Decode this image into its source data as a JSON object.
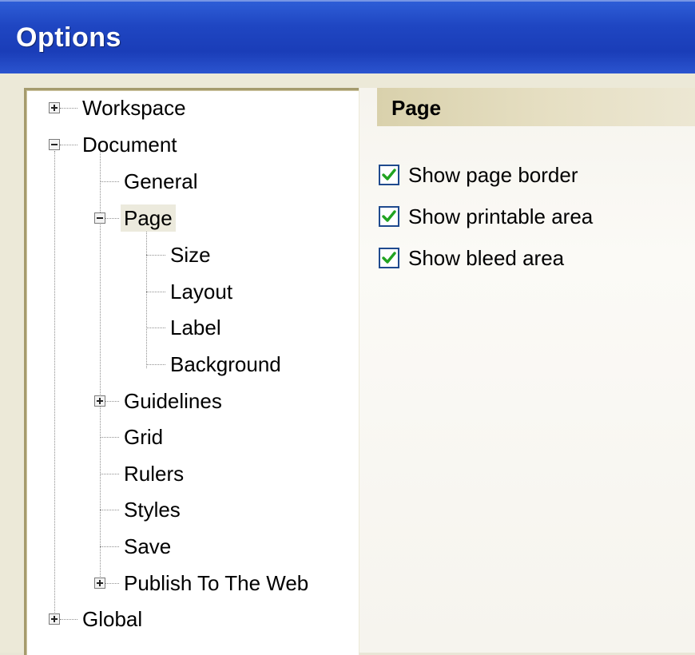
{
  "window": {
    "title": "Options"
  },
  "tree": {
    "workspace": "Workspace",
    "document": "Document",
    "general": "General",
    "page": "Page",
    "size": "Size",
    "layout": "Layout",
    "label": "Label",
    "background": "Background",
    "guidelines": "Guidelines",
    "grid": "Grid",
    "rulers": "Rulers",
    "styles": "Styles",
    "save": "Save",
    "publish": "Publish To The Web",
    "global": "Global"
  },
  "panel": {
    "title": "Page",
    "options": [
      {
        "label": "Show page border",
        "checked": true
      },
      {
        "label": "Show printable area",
        "checked": true
      },
      {
        "label": "Show bleed area",
        "checked": true
      }
    ]
  },
  "colors": {
    "titlebar": "#1f46c2",
    "check_green": "#21a321",
    "selected_bg": "#eceadd"
  }
}
